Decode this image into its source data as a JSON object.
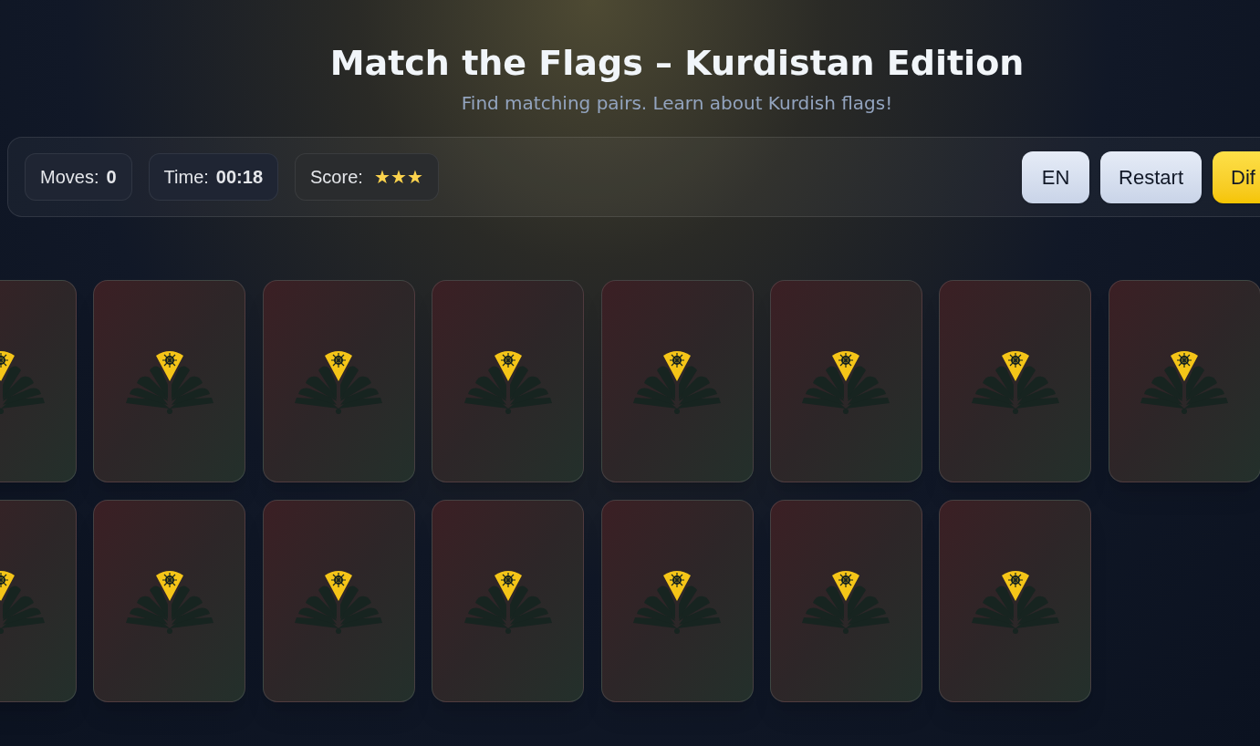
{
  "header": {
    "title": "Match the Flags – Kurdistan Edition",
    "subtitle": "Find matching pairs. Learn about Kurdish flags!"
  },
  "stats": [
    {
      "label": "Moves:",
      "value": "0"
    },
    {
      "label": "Time:",
      "value": "00:18"
    }
  ],
  "score": {
    "label": "Score:",
    "stars": 3
  },
  "buttons": [
    {
      "label": "EN",
      "kind": "secondary"
    },
    {
      "label": "Restart",
      "kind": "secondary"
    },
    {
      "label": "Dif",
      "kind": "primary"
    }
  ],
  "cards": [
    {
      "flipped": false
    },
    {
      "flipped": false
    },
    {
      "flipped": false
    },
    {
      "flipped": false
    },
    {
      "flipped": false
    },
    {
      "flipped": false
    },
    {
      "flipped": false
    },
    {
      "flipped": false
    },
    {
      "flipped": false
    },
    {
      "flipped": false
    },
    {
      "flipped": false
    },
    {
      "flipped": false
    },
    {
      "flipped": false
    },
    {
      "flipped": false
    },
    {
      "flipped": false
    }
  ]
}
